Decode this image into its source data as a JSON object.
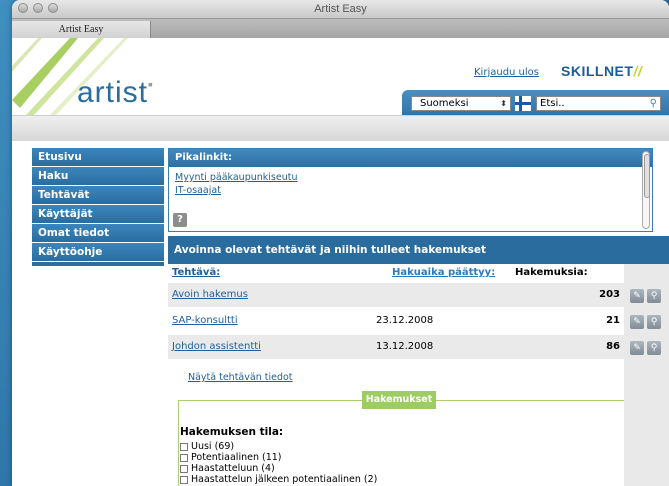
{
  "window": {
    "title": "Artist Easy",
    "tab_label": "Artist Easy"
  },
  "header": {
    "logo_text": "artist",
    "logo_mark": "▪",
    "login_link": "Kirjaudu ulos",
    "partner_logo": "SKILLNET",
    "language_selected": "Suomeksi",
    "search_placeholder": "Etsi.."
  },
  "nav": {
    "items": [
      {
        "label": "Etusivu"
      },
      {
        "label": "Haku"
      },
      {
        "label": "Tehtävät"
      },
      {
        "label": "Käyttäjät"
      },
      {
        "label": "Omat tiedot"
      },
      {
        "label": "Käyttöohje"
      }
    ]
  },
  "quick_links": {
    "title": "Pikalinkit:",
    "links": [
      "Myynti pääkaupunkiseutu",
      "IT-osaajat"
    ],
    "help_label": "?"
  },
  "tasks": {
    "title": "Avoinna olevat tehtävät ja niihin tulleet hakemukset",
    "columns": {
      "task": "Tehtävä:",
      "deadline": "Hakuaika päättyy:",
      "applications": "Hakemuksia:"
    },
    "rows": [
      {
        "task": "Avoin hakemus",
        "deadline": "",
        "count": "203"
      },
      {
        "task": "SAP-konsultti",
        "deadline": "23.12.2008",
        "count": "21"
      },
      {
        "task": "Johdon assistentti",
        "deadline": "13.12.2008",
        "count": "86"
      }
    ],
    "show_details_link": "Näytä tehtävän tiedot"
  },
  "applications": {
    "label": "Hakemukset",
    "status_title": "Hakemuksen tila:",
    "options": [
      "Uusi (69)",
      "Potentiaalinen (11)",
      "Haastatteluun (4)",
      "Haastattelun jälkeen potentiaalinen (2)"
    ]
  },
  "colors": {
    "primary_blue": "#2b6c9e",
    "accent_green": "#9ccc62",
    "link_blue": "#1f5f9a"
  }
}
